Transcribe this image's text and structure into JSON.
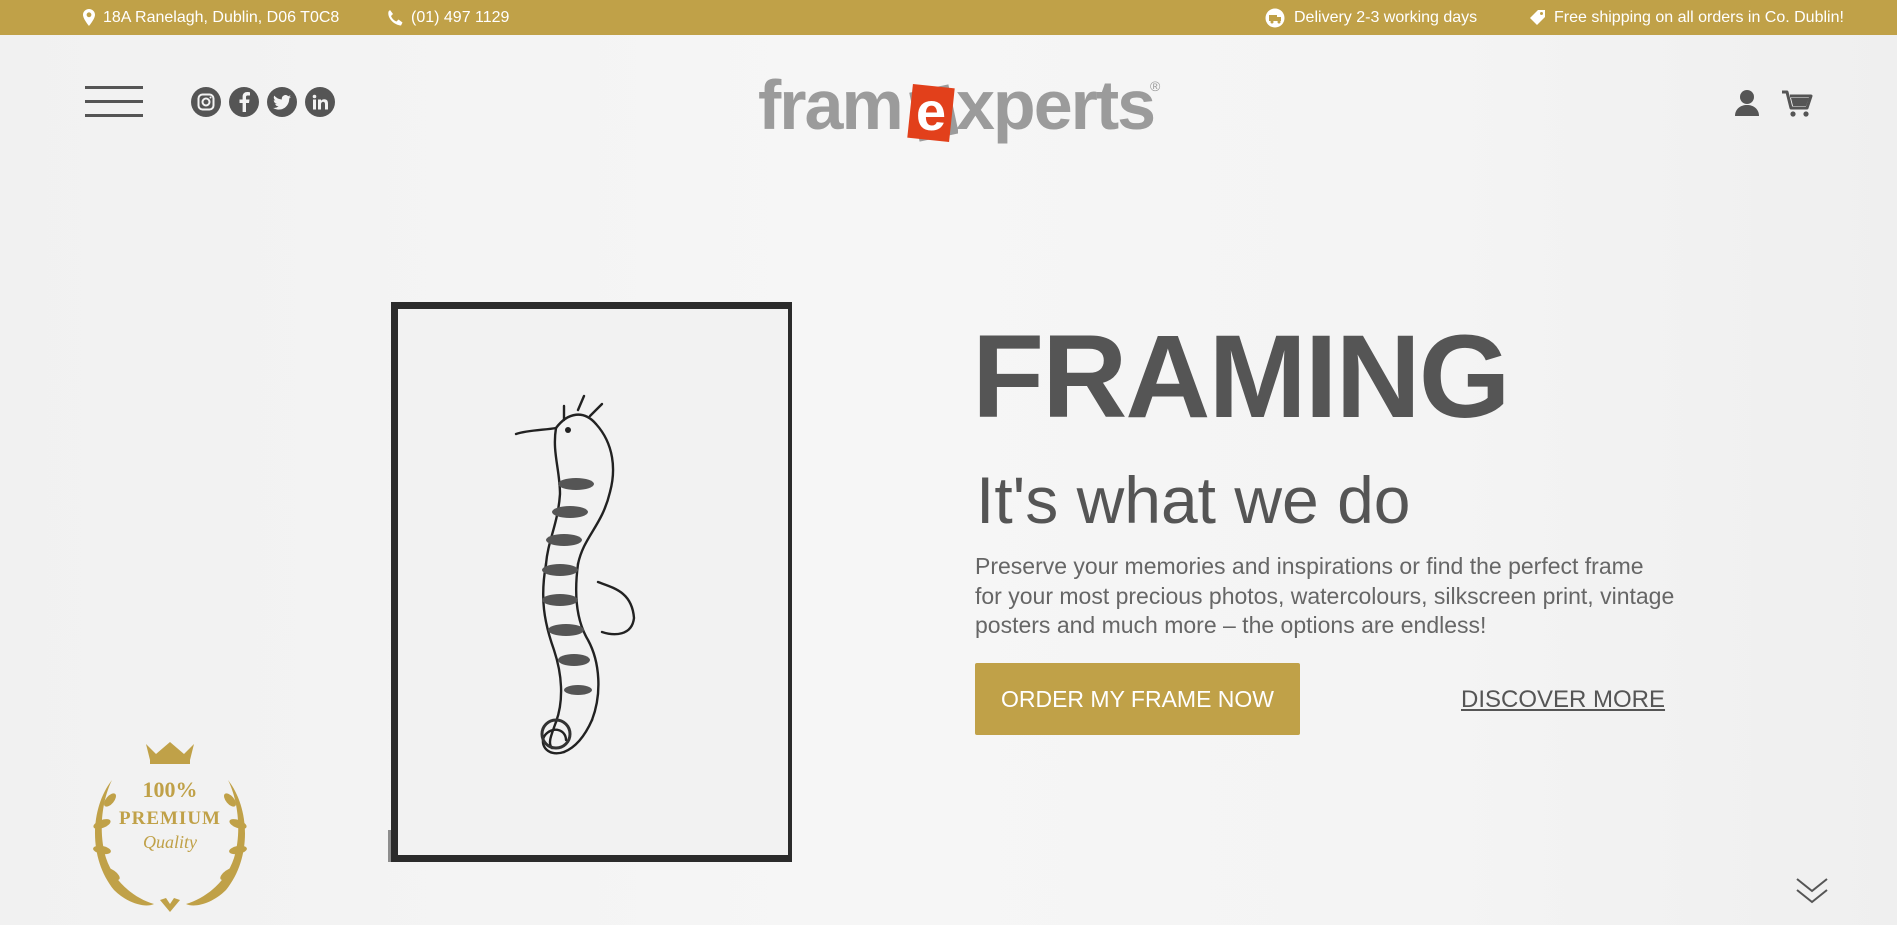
{
  "topbar": {
    "address": "18A Ranelagh, Dublin, D06 T0C8",
    "phone": "(01) 497 1129",
    "delivery": "Delivery 2-3 working days",
    "shipping": "Free shipping on all orders in Co. Dublin!"
  },
  "header": {
    "logo_part1": "fram",
    "logo_e": "e",
    "logo_part2": "xperts",
    "logo_registered": "®",
    "social_icons": [
      "instagram-icon",
      "facebook-icon",
      "twitter-icon",
      "linkedin-icon"
    ]
  },
  "hero": {
    "headline": "FRAMING",
    "subhead": "It's what we do",
    "body": "Preserve your memories and inspirations or find the perfect frame for your most precious photos, watercolours, silkscreen print, vintage posters and much more – the options are endless!",
    "order_button": "ORDER MY FRAME NOW",
    "discover_link": "DISCOVER MORE"
  },
  "badge": {
    "line1": "100%",
    "line2": "PREMIUM",
    "line3": "Quality"
  },
  "colors": {
    "gold": "#c0a148",
    "text_dark": "#555555",
    "logo_grey": "#9b9b9b",
    "logo_red": "#e2401b"
  }
}
